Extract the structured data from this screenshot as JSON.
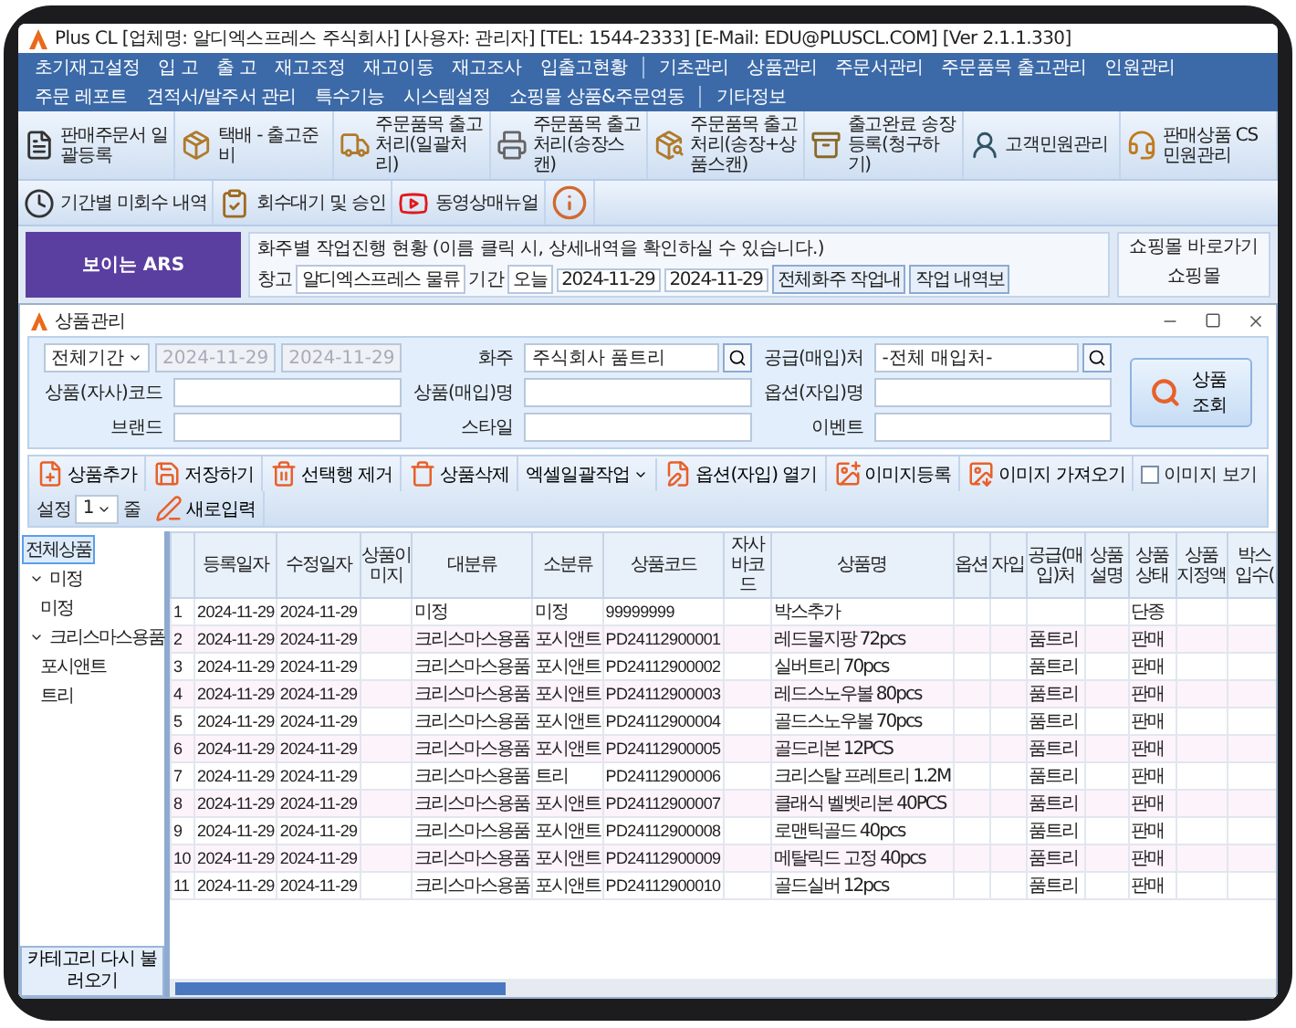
{
  "window": {
    "title": "Plus CL  [업체명: 알디엑스프레스 주식회사]  [사용자: 관리자]  [TEL: 1544-2333]  [E-Mail: EDU@PLUSCL.COM]  [Ver 2.1.1.330]"
  },
  "menu": [
    {
      "kind": "item",
      "label": "초기재고설정"
    },
    {
      "kind": "item",
      "label": "입 고"
    },
    {
      "kind": "item",
      "label": "출 고"
    },
    {
      "kind": "item",
      "label": "재고조정"
    },
    {
      "kind": "item",
      "label": "재고이동"
    },
    {
      "kind": "item",
      "label": "재고조사"
    },
    {
      "kind": "item",
      "label": "입출고현황"
    },
    {
      "kind": "separator"
    },
    {
      "kind": "item",
      "label": "기초관리"
    },
    {
      "kind": "item",
      "label": "상품관리"
    },
    {
      "kind": "item",
      "label": "주문서관리"
    },
    {
      "kind": "item",
      "label": "주문품목 출고관리"
    },
    {
      "kind": "item",
      "label": "인원관리"
    },
    {
      "kind": "item",
      "label": "주문 레포트"
    },
    {
      "kind": "item",
      "label": "견적서/발주서 관리"
    },
    {
      "kind": "item",
      "label": "특수기능"
    },
    {
      "kind": "item",
      "label": "시스템설정"
    },
    {
      "kind": "item",
      "label": "쇼핑몰 상품&주문연동"
    },
    {
      "kind": "separator"
    },
    {
      "kind": "item",
      "label": "기타정보"
    }
  ],
  "toolbar": [
    [
      {
        "label": "판매주문서 일괄등록"
      },
      {
        "label": "택배 - 출고준비"
      },
      {
        "label": "주문품목 출고처리(일괄처리)"
      },
      {
        "label": "주문품목 출고처리(송장스캔)"
      },
      {
        "label": "주문품목 출고처리(송장+상품스캔)"
      },
      {
        "label": "출고완료 송장등록(청구하기)"
      },
      {
        "label": "고객민원관리"
      },
      {
        "label": "판매상품 CS 민원관리"
      }
    ],
    [
      {
        "label": "기간별 미회수 내역"
      },
      {
        "label": "회수대기 및 승인"
      },
      {
        "label": "동영상매뉴얼"
      },
      {
        "kind": "info"
      }
    ]
  ],
  "dashboard": {
    "banner": "보이는 ARS",
    "title": "화주별 작업진행 현황 (이름 클릭 시, 상세내역을 확인하실 수 있습니다.)",
    "warehouse_label": "창고",
    "warehouse": "알디엑스프레스 물류",
    "period_label": "기간",
    "period": "오늘",
    "date_from": "2024-11-29",
    "date_to": "2024-11-29",
    "buttons": [
      "전체화주 작업내",
      "작업 내역보"
    ],
    "side_title": "쇼핑몰 바로가기",
    "side_header": "쇼핑몰"
  },
  "product_window": {
    "title": "상품관리",
    "period": "전체기간",
    "dates_disabled": true,
    "date_from": "2024-11-29",
    "date_to": "2024-11-29",
    "fields": [
      {
        "label": "화주",
        "value": "주식회사 품트리",
        "search": true
      },
      {
        "label": "공급(매입)처",
        "value": "-전체 매입처-",
        "search": true
      },
      {
        "label": "상품(자사)코드",
        "search": false
      },
      {
        "label": "상품(매입)명",
        "search": false
      },
      {
        "label": "옵션(자입)명",
        "search": false
      },
      {
        "label": "브랜드",
        "search": false
      },
      {
        "label": "스타일",
        "search": false
      },
      {
        "label": "이벤트",
        "search": false
      }
    ],
    "search_button": "상품조회",
    "actions": [
      {
        "kind": "button",
        "label": "상품추가"
      },
      {
        "kind": "button",
        "label": "저장하기"
      },
      {
        "kind": "button",
        "label": "선택행 제거"
      },
      {
        "kind": "button",
        "label": "상품삭제"
      },
      {
        "kind": "dropdown",
        "label": "엑셀일괄작업"
      },
      {
        "kind": "button",
        "label": "옵션(자입) 열기"
      },
      {
        "kind": "button",
        "label": "이미지등록"
      },
      {
        "kind": "button",
        "label": "이미지 가져오기"
      },
      {
        "kind": "checkbox",
        "label": "이미지 보기",
        "checked": false
      },
      {
        "kind": "spinner",
        "label": "설정",
        "value": "1",
        "unit": "줄"
      },
      {
        "kind": "button",
        "label": "새로입력"
      }
    ],
    "category_tree": [
      {
        "label": "전체상품",
        "selected": true,
        "children": [
          {
            "label": "미정",
            "expanded": true,
            "selected": false,
            "children": [
              {
                "label": "미정",
                "selected": false
              }
            ]
          },
          {
            "label": "크리스마스용품",
            "expanded": true,
            "selected": false,
            "children": [
              {
                "label": "포시앤트",
                "selected": false
              },
              {
                "label": "트리",
                "selected": false
              }
            ]
          }
        ]
      }
    ],
    "reload_button": "카테고리 다시 불러오기",
    "table": {
      "columns": [
        "",
        "등록일자",
        "수정일자",
        "상품이미지",
        "대분류",
        "소분류",
        "상품코드",
        "자사바코드",
        "상품명",
        "옵션",
        "자입",
        "공급(매입)처",
        "상품설명",
        "상품상태",
        "상품 지정액",
        "박스 입수("
      ],
      "rows": [
        [
          "1",
          "2024-11-29",
          "2024-11-29",
          "",
          "미정",
          "미정",
          "99999999",
          "",
          "박스추가",
          "",
          "",
          "",
          "",
          "단종",
          "",
          ""
        ],
        [
          "2",
          "2024-11-29",
          "2024-11-29",
          "",
          "크리스마스용품",
          "포시앤트",
          "PD24112900001",
          "",
          "레드물지팡 72pcs",
          "",
          "",
          "품트리",
          "",
          "판매",
          "",
          ""
        ],
        [
          "3",
          "2024-11-29",
          "2024-11-29",
          "",
          "크리스마스용품",
          "포시앤트",
          "PD24112900002",
          "",
          "실버트리 70pcs",
          "",
          "",
          "품트리",
          "",
          "판매",
          "",
          ""
        ],
        [
          "4",
          "2024-11-29",
          "2024-11-29",
          "",
          "크리스마스용품",
          "포시앤트",
          "PD24112900003",
          "",
          "레드스노우볼 80pcs",
          "",
          "",
          "품트리",
          "",
          "판매",
          "",
          ""
        ],
        [
          "5",
          "2024-11-29",
          "2024-11-29",
          "",
          "크리스마스용품",
          "포시앤트",
          "PD24112900004",
          "",
          "골드스노우볼 70pcs",
          "",
          "",
          "품트리",
          "",
          "판매",
          "",
          ""
        ],
        [
          "6",
          "2024-11-29",
          "2024-11-29",
          "",
          "크리스마스용품",
          "포시앤트",
          "PD24112900005",
          "",
          "골드리본 12PCS",
          "",
          "",
          "품트리",
          "",
          "판매",
          "",
          ""
        ],
        [
          "7",
          "2024-11-29",
          "2024-11-29",
          "",
          "크리스마스용품",
          "트리",
          "PD24112900006",
          "",
          "크리스탈 프레트리 1.2M",
          "",
          "",
          "품트리",
          "",
          "판매",
          "",
          ""
        ],
        [
          "8",
          "2024-11-29",
          "2024-11-29",
          "",
          "크리스마스용품",
          "포시앤트",
          "PD24112900007",
          "",
          "클래식 벨벳리본 40PCS",
          "",
          "",
          "품트리",
          "",
          "판매",
          "",
          ""
        ],
        [
          "9",
          "2024-11-29",
          "2024-11-29",
          "",
          "크리스마스용품",
          "포시앤트",
          "PD24112900008",
          "",
          "로맨틱골드 40pcs",
          "",
          "",
          "품트리",
          "",
          "판매",
          "",
          ""
        ],
        [
          "10",
          "2024-11-29",
          "2024-11-29",
          "",
          "크리스마스용품",
          "포시앤트",
          "PD24112900009",
          "",
          "메탈릭드 고정 40pcs",
          "",
          "",
          "품트리",
          "",
          "판매",
          "",
          ""
        ],
        [
          "11",
          "2024-11-29",
          "2024-11-29",
          "",
          "크리스마스용품",
          "포시앤트",
          "PD24112900010",
          "",
          "골드실버 12pcs",
          "",
          "",
          "품트리",
          "",
          "판매",
          "",
          ""
        ]
      ]
    }
  }
}
